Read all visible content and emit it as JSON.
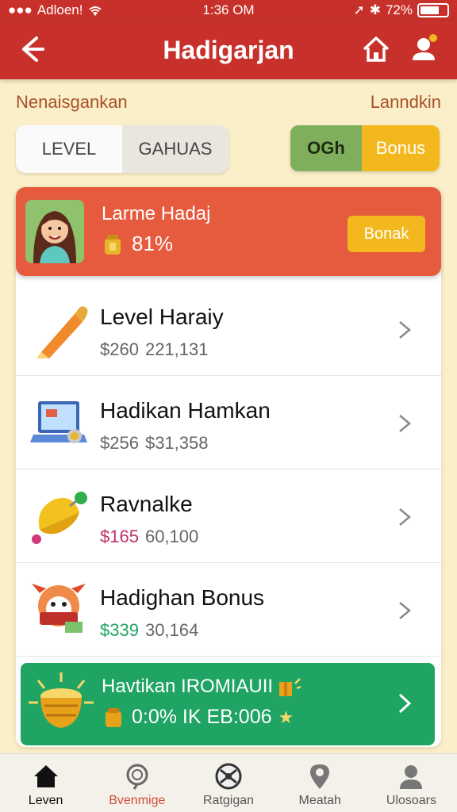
{
  "status_bar": {
    "carrier": "Adloen!",
    "time": "1:36 OM",
    "battery": "72%",
    "battery_level": 0.72
  },
  "nav": {
    "title": "Hadigarjan",
    "back_icon": "back-arrow-icon",
    "home_icon": "home-icon",
    "user_icon": "user-icon"
  },
  "subheader": {
    "left": "Nenaisgankan",
    "right": "Lanndkin"
  },
  "segments": [
    "LEVEL",
    "GAHUAS"
  ],
  "pill": {
    "left": "OGh",
    "right": "Bonus"
  },
  "banner": {
    "title": "Larme Hadaj",
    "stat": "81%",
    "button": "Bonak"
  },
  "rows": [
    {
      "title": "Level Haraiy",
      "sub_a": "$260",
      "sub_b": "221,131",
      "accent": "#666666"
    },
    {
      "title": "Hadikan Hamkan",
      "sub_a": "$256",
      "sub_b": "$31,358",
      "accent": "#666666"
    },
    {
      "title": "Ravnalke",
      "sub_a": "$165",
      "sub_b": "60,100",
      "accent": "#c0306a"
    },
    {
      "title": "Hadighan Bonus",
      "sub_a": "$339",
      "sub_b": "30,164",
      "accent": "#1fa463"
    }
  ],
  "promo": {
    "title": "Havtikan IROMIAUII",
    "sub": "0:0% IK EB:006"
  },
  "tabs": [
    "Leven",
    "Bvenmige",
    "Ratgigan",
    "Meatah",
    "Ulosoars"
  ],
  "colors": {
    "brand_red": "#c8312b",
    "banner_orange": "#e65a3e",
    "gold": "#f2b81e",
    "green": "#1fa463",
    "background": "#fbefc9"
  }
}
